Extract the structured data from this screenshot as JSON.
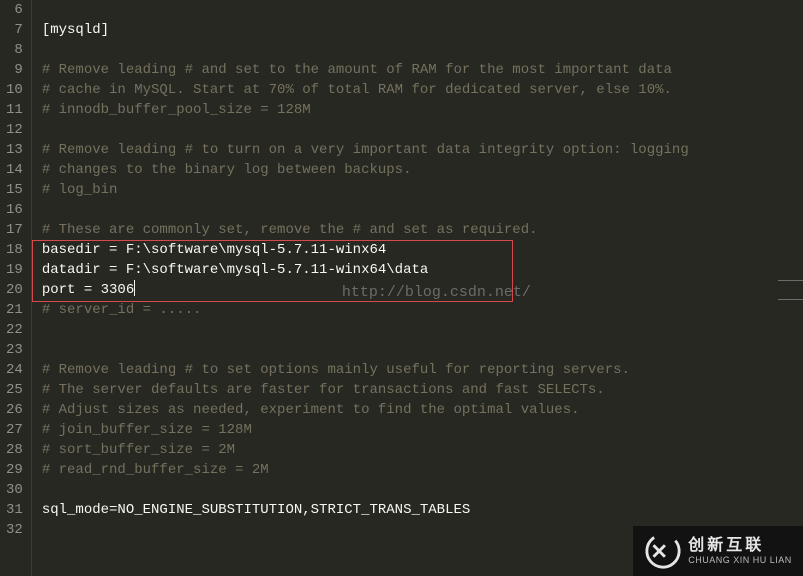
{
  "gutter": {
    "start": 6,
    "end": 32
  },
  "watermark": "http://blog.csdn.net/",
  "lines": [
    {
      "n": 6,
      "text": "",
      "cls": ""
    },
    {
      "n": 7,
      "text": "[mysqld]",
      "cls": ""
    },
    {
      "n": 8,
      "text": "",
      "cls": ""
    },
    {
      "n": 9,
      "text": "# Remove leading # and set to the amount of RAM for the most important data",
      "cls": "comment"
    },
    {
      "n": 10,
      "text": "# cache in MySQL. Start at 70% of total RAM for dedicated server, else 10%.",
      "cls": "comment"
    },
    {
      "n": 11,
      "text": "# innodb_buffer_pool_size = 128M",
      "cls": "comment"
    },
    {
      "n": 12,
      "text": "",
      "cls": ""
    },
    {
      "n": 13,
      "text": "# Remove leading # to turn on a very important data integrity option: logging",
      "cls": "comment"
    },
    {
      "n": 14,
      "text": "# changes to the binary log between backups.",
      "cls": "comment"
    },
    {
      "n": 15,
      "text": "# log_bin",
      "cls": "comment"
    },
    {
      "n": 16,
      "text": "",
      "cls": ""
    },
    {
      "n": 17,
      "text": "# These are commonly set, remove the # and set as required.",
      "cls": "comment"
    },
    {
      "n": 18,
      "text": "basedir = F:\\software\\mysql-5.7.11-winx64",
      "cls": ""
    },
    {
      "n": 19,
      "text": "datadir = F:\\software\\mysql-5.7.11-winx64\\data",
      "cls": ""
    },
    {
      "n": 20,
      "text": "port = 3306",
      "cls": "",
      "caret": true
    },
    {
      "n": 21,
      "text": "# server_id = .....",
      "cls": "comment"
    },
    {
      "n": 22,
      "text": "",
      "cls": ""
    },
    {
      "n": 23,
      "text": "",
      "cls": ""
    },
    {
      "n": 24,
      "text": "# Remove leading # to set options mainly useful for reporting servers.",
      "cls": "comment"
    },
    {
      "n": 25,
      "text": "# The server defaults are faster for transactions and fast SELECTs.",
      "cls": "comment"
    },
    {
      "n": 26,
      "text": "# Adjust sizes as needed, experiment to find the optimal values.",
      "cls": "comment"
    },
    {
      "n": 27,
      "text": "# join_buffer_size = 128M",
      "cls": "comment"
    },
    {
      "n": 28,
      "text": "# sort_buffer_size = 2M",
      "cls": "comment"
    },
    {
      "n": 29,
      "text": "# read_rnd_buffer_size = 2M",
      "cls": "comment"
    },
    {
      "n": 30,
      "text": "",
      "cls": ""
    },
    {
      "n": 31,
      "text": "sql_mode=NO_ENGINE_SUBSTITUTION,STRICT_TRANS_TABLES",
      "cls": ""
    },
    {
      "n": 32,
      "text": "",
      "cls": ""
    }
  ],
  "logo": {
    "cn": "创新互联",
    "en": "CHUANG XIN HU LIAN"
  }
}
